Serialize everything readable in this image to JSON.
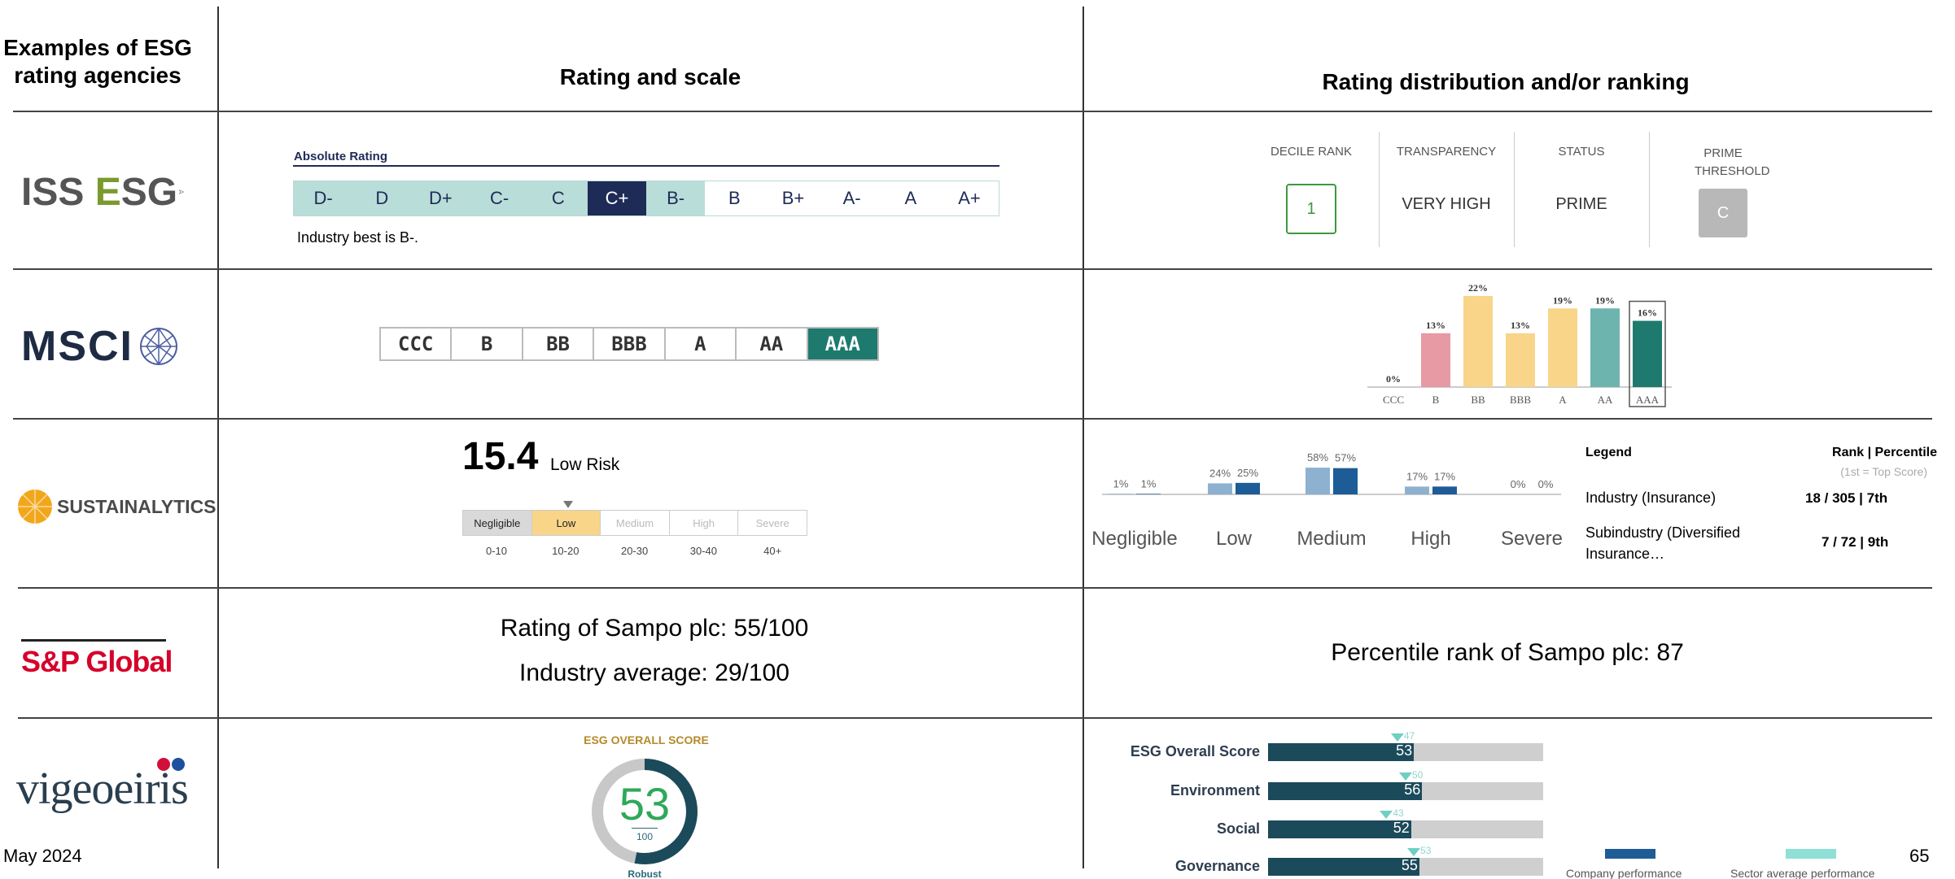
{
  "headers": {
    "agencies": "Examples of ESG rating agencies",
    "rating": "Rating and scale",
    "distribution": "Rating distribution and/or ranking"
  },
  "logos": {
    "iss": "ISS ESG",
    "msci": "MSCI",
    "sustainalytics": "SUSTAINALYTICS",
    "sp": "S&P Global",
    "vigeo": "vigeoeiris"
  },
  "iss": {
    "title": "Absolute Rating",
    "scale": [
      "D-",
      "D",
      "D+",
      "C-",
      "C",
      "C+",
      "B-",
      "B",
      "B+",
      "A-",
      "A",
      "A+"
    ],
    "selected": "C+",
    "note": "Industry best is B-.",
    "decile": {
      "labels": [
        "DECILE RANK",
        "TRANSPARENCY",
        "STATUS",
        "PRIME THRESHOLD"
      ],
      "values": [
        "1",
        "VERY HIGH",
        "PRIME",
        "C"
      ]
    }
  },
  "msci": {
    "scale": [
      "CCC",
      "B",
      "BB",
      "BBB",
      "A",
      "AA",
      "AAA"
    ],
    "selected": "AAA"
  },
  "sustainalytics": {
    "score": "15.4",
    "risk_label": "Low Risk",
    "categories": [
      "Negligible",
      "Low",
      "Medium",
      "High",
      "Severe"
    ],
    "ranges": [
      "0-10",
      "10-20",
      "20-30",
      "30-40",
      "40+"
    ],
    "legend": {
      "title": "Legend",
      "rank_header": "Rank | Percentile",
      "rank_sub": "(1st = Top Score)",
      "rows": [
        {
          "name": "Industry (Insurance)",
          "rank": "18 / 305 | 7th"
        },
        {
          "name": "Subindustry (Diversified Insurance…",
          "rank": "7 / 72 | 9th"
        }
      ]
    }
  },
  "sp": {
    "rating": "Rating of Sampo plc: 55/100",
    "average": "Industry average: 29/100",
    "percentile": "Percentile rank of Sampo plc: 87"
  },
  "vigeo": {
    "overall_title": "ESG OVERALL SCORE",
    "overall_score": "53",
    "overall_max": "100",
    "overall_label": "Robust",
    "legend_company": "Company performance",
    "legend_sector": "Sector average performance"
  },
  "footer": {
    "date": "May 2024",
    "page": "65"
  },
  "colors": {
    "iss_selected": "#1e2b57",
    "iss_light": "#b9ddd9",
    "msci_selected": "#1e7a6e",
    "sus_low": "#f9d58a",
    "sus_bar_light": "#8fb1d0",
    "sus_bar_dark": "#1d5c97",
    "vigeo_dark": "#1b4a5a",
    "vigeo_sector": "#6fcfc3"
  },
  "chart_data": [
    {
      "type": "bar",
      "categories": [
        "CCC",
        "B",
        "BB",
        "BBB",
        "A",
        "AA",
        "AAA"
      ],
      "values": [
        0,
        13,
        22,
        13,
        19,
        19,
        16
      ],
      "value_labels": [
        "0%",
        "13%",
        "22%",
        "13%",
        "19%",
        "19%",
        "16%"
      ],
      "ylim": [
        0,
        22
      ]
    },
    {
      "type": "bar",
      "categories": [
        "Negligible",
        "Low",
        "Medium",
        "High",
        "Severe"
      ],
      "series": [
        {
          "values": [
            1,
            24,
            58,
            17,
            0
          ],
          "labels": [
            "1%",
            "24%",
            "58%",
            "17%",
            "0%"
          ]
        },
        {
          "values": [
            1,
            25,
            57,
            17,
            0
          ],
          "labels": [
            "1%",
            "25%",
            "57%",
            "17%",
            "0%"
          ]
        }
      ],
      "ylim": [
        0,
        60
      ]
    },
    {
      "type": "bar",
      "categories": [
        "ESG Overall Score",
        "Environment",
        "Social",
        "Governance"
      ],
      "series": [
        {
          "name": "Company performance",
          "values": [
            53,
            56,
            52,
            55
          ]
        },
        {
          "name": "Sector average performance",
          "values": [
            47,
            50,
            43,
            53
          ]
        }
      ],
      "xlim": [
        0,
        100
      ]
    }
  ]
}
